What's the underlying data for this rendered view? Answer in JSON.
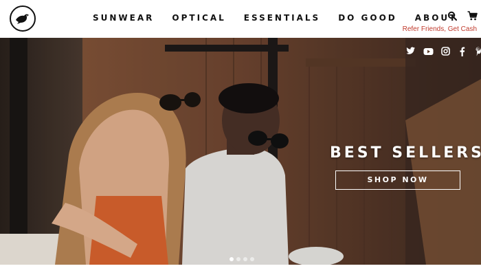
{
  "header": {
    "logo_icon": "bird-icon",
    "nav": [
      {
        "label": "SUNWEAR"
      },
      {
        "label": "OPTICAL"
      },
      {
        "label": "ESSENTIALS"
      },
      {
        "label": "DO GOOD"
      },
      {
        "label": "ABOUT"
      }
    ],
    "search_icon": "search-icon",
    "cart_icon": "cart-icon",
    "refer_link": "Refer Friends, Get Cash"
  },
  "hero": {
    "title": "BEST SELLERS",
    "button_label": "SHOP NOW",
    "social_icons": [
      "twitter-icon",
      "youtube-icon",
      "instagram-icon",
      "facebook-icon",
      "pinterest-icon"
    ],
    "slides": {
      "count": 4,
      "active": 1
    }
  },
  "colors": {
    "accent": "#c0392b",
    "text": "#111111",
    "overlay_text": "#ffffff"
  }
}
